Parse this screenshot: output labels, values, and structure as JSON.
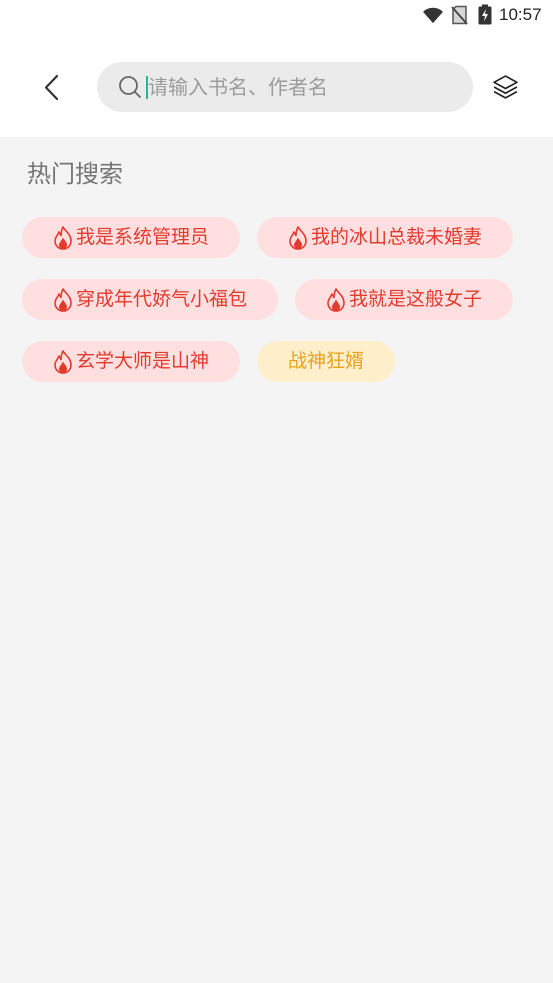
{
  "status_bar": {
    "time": "10:57",
    "wifi_icon": "wifi-icon",
    "sim_icon": "no-sim-icon",
    "battery_icon": "battery-charging-icon"
  },
  "header": {
    "back_icon": "chevron-left-icon",
    "search": {
      "icon": "search-icon",
      "placeholder": "请输入书名、作者名",
      "value": ""
    },
    "shelf_icon": "layers-icon"
  },
  "hot_search": {
    "title": "热门搜索",
    "hot_icon": "fire-icon",
    "tags": [
      {
        "label": "我是系统管理员",
        "hot": true
      },
      {
        "label": "我的冰山总裁未婚妻",
        "hot": true
      },
      {
        "label": "穿成年代娇气小福包",
        "hot": true
      },
      {
        "label": "我就是这般女子",
        "hot": true
      },
      {
        "label": "玄学大师是山神",
        "hot": true
      },
      {
        "label": "战神狂婿",
        "hot": false
      }
    ]
  },
  "colors": {
    "page_bg": "#f4f4f4",
    "hot_bg": "#ffdfdf",
    "hot_text": "#e23b2e",
    "normal_bg": "#fff0cb",
    "normal_text": "#e9a21f"
  }
}
